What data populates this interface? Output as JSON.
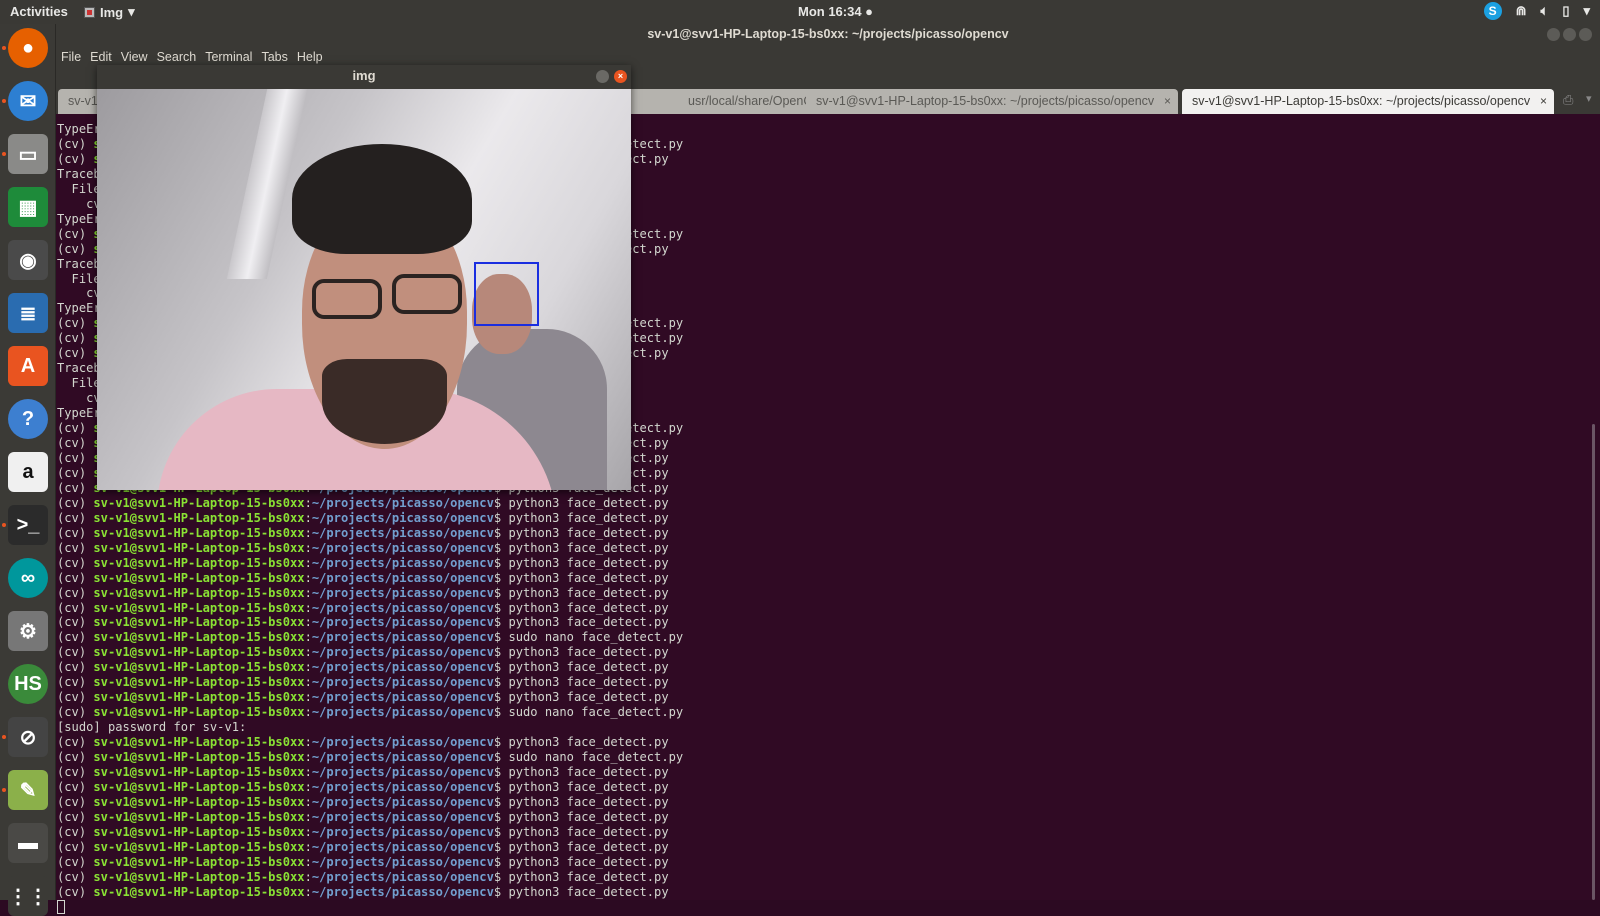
{
  "topbar": {
    "activities": "Activities",
    "app": "Img",
    "clock": "Mon 16:34 ●"
  },
  "launcher": [
    "firefox",
    "thunderbird",
    "files",
    "calc",
    "rhythmbox",
    "writer",
    "software",
    "help",
    "amazon",
    "terminal",
    "arduino",
    "settings",
    "hs",
    "blocked",
    "image-viewer",
    "trash",
    "apps"
  ],
  "window": {
    "title": "sv-v1@svv1-HP-Laptop-15-bs0xx: ~/projects/picasso/opencv",
    "menu": [
      "File",
      "Edit",
      "View",
      "Search",
      "Terminal",
      "Tabs",
      "Help"
    ],
    "tabs": [
      {
        "label": "sv-v1@"
      },
      {
        "label": "usr/local/share/OpenCV..."
      },
      {
        "label": "sv-v1@svv1-HP-Laptop-15-bs0xx: ~/projects/picasso/opencv"
      },
      {
        "label": "sv-v1@svv1-HP-Laptop-15-bs0xx: ~/projects/picasso/opencv",
        "active": true
      }
    ],
    "close": "×"
  },
  "img_window": {
    "title": "img",
    "close": "×"
  },
  "prompt": {
    "env": "(cv) ",
    "user": "sv-v1@svv1-HP-Laptop-15-bs0xx",
    "sep": ":",
    "path": "~/projects/picasso/opencv",
    "dollar": "$ "
  },
  "lines": [
    {
      "t": "TypeEr"
    },
    {
      "c": "sudo nano face_detect.py"
    },
    {
      "c": "python3 face_detect.py"
    },
    {
      "t": "Traceb"
    },
    {
      "t": "  File"
    },
    {
      "t": "    cv"
    },
    {
      "t": "TypeEr"
    },
    {
      "c": "sudo nano face_detect.py"
    },
    {
      "c": "python3 face_detect.py"
    },
    {
      "t": "Traceb"
    },
    {
      "t": "  File"
    },
    {
      "t": "    cv"
    },
    {
      "t": "TypeEr"
    },
    {
      "c": "sudo nano face_detect.py"
    },
    {
      "c": "sudo nano face_detect.py"
    },
    {
      "c": "python3 face_detect.py"
    },
    {
      "t": "Traceb"
    },
    {
      "t": "  File"
    },
    {
      "t": "    cv"
    },
    {
      "t": "TypeEr"
    },
    {
      "c": "sudo nano face_detect.py"
    },
    {
      "c": "python3 face_detect.py"
    },
    {
      "c": "python3 face_detect.py"
    },
    {
      "c": "python3 face_detect.py"
    },
    {
      "c": "python3 face_detect.py"
    },
    {
      "c": "python3 face_detect.py"
    },
    {
      "c": "python3 face_detect.py"
    },
    {
      "c": "python3 face_detect.py"
    },
    {
      "c": "python3 face_detect.py"
    },
    {
      "c": "python3 face_detect.py"
    },
    {
      "c": "python3 face_detect.py"
    },
    {
      "c": "python3 face_detect.py"
    },
    {
      "c": "python3 face_detect.py"
    },
    {
      "c": "python3 face_detect.py"
    },
    {
      "c": "sudo nano face_detect.py"
    },
    {
      "c": "python3 face_detect.py"
    },
    {
      "c": "python3 face_detect.py"
    },
    {
      "c": "python3 face_detect.py"
    },
    {
      "c": "python3 face_detect.py"
    },
    {
      "c": "sudo nano face_detect.py"
    },
    {
      "t": "[sudo] password for sv-v1:"
    },
    {
      "c": "python3 face_detect.py"
    },
    {
      "c": "sudo nano face_detect.py"
    },
    {
      "c": "python3 face_detect.py"
    },
    {
      "c": "python3 face_detect.py"
    },
    {
      "c": "python3 face_detect.py"
    },
    {
      "c": "python3 face_detect.py"
    },
    {
      "c": "python3 face_detect.py"
    },
    {
      "c": "python3 face_detect.py"
    },
    {
      "c": "python3 face_detect.py"
    },
    {
      "c": "python3 face_detect.py"
    },
    {
      "c": "python3 face_detect.py"
    }
  ]
}
